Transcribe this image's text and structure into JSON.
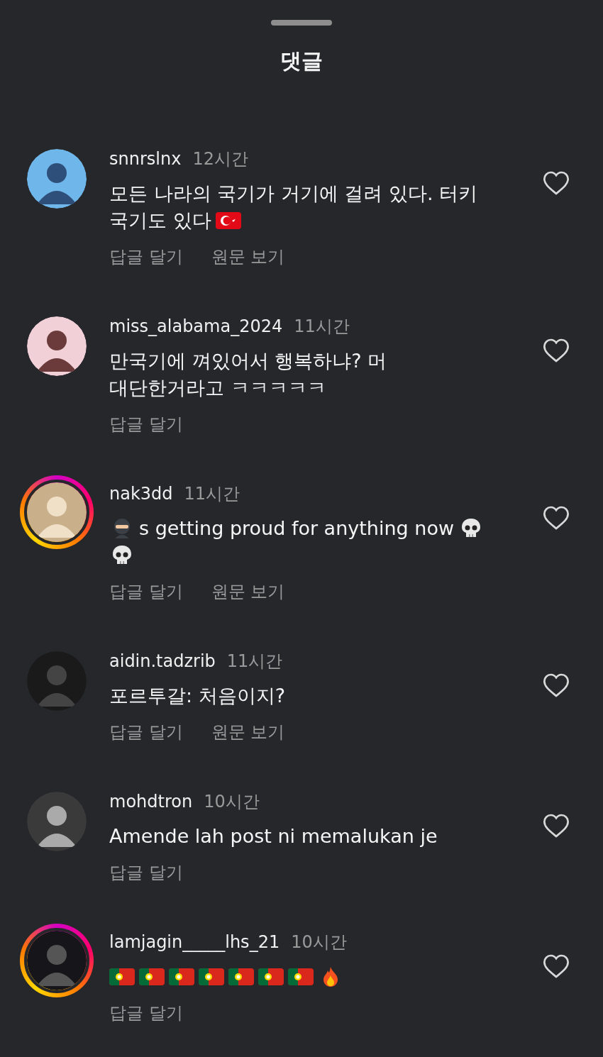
{
  "title": "댓글",
  "comments": [
    {
      "username": "snnrslnx",
      "time": "12시간",
      "story_ring": false,
      "liked": false,
      "lines": [
        [
          {
            "kind": "text",
            "text": "모든 나라의 국기가 거기에 걸려 있다. 터키"
          }
        ],
        [
          {
            "kind": "text",
            "text": "국기도 있다"
          },
          {
            "kind": "flag-tr"
          }
        ]
      ],
      "reply": "답글 달기",
      "translate": "원문 보기"
    },
    {
      "username": "miss_alabama_2024",
      "time": "11시간",
      "story_ring": false,
      "liked": false,
      "lines": [
        [
          {
            "kind": "text",
            "text": "만국기에 껴있어서 행복하냐? 머"
          }
        ],
        [
          {
            "kind": "text",
            "text": "대단한거라고 ㅋㅋㅋㅋㅋ"
          }
        ]
      ],
      "reply": "답글 달기"
    },
    {
      "username": "nak3dd",
      "time": "11시간",
      "story_ring": true,
      "liked": false,
      "lines": [
        [
          {
            "kind": "ninja"
          },
          {
            "kind": "text",
            "text": "s getting proud for anything now"
          },
          {
            "kind": "skull"
          }
        ],
        [
          {
            "kind": "skull"
          }
        ]
      ],
      "reply": "답글 달기",
      "translate": "원문 보기"
    },
    {
      "username": "aidin.tadzrib",
      "time": "11시간",
      "story_ring": false,
      "liked": false,
      "lines": [
        [
          {
            "kind": "text",
            "text": "포르투갈: 처음이지?"
          }
        ]
      ],
      "reply": "답글 달기",
      "translate": "원문 보기"
    },
    {
      "username": "mohdtron",
      "time": "10시간",
      "story_ring": false,
      "liked": false,
      "lines": [
        [
          {
            "kind": "text",
            "text": "Amende lah post ni memalukan je"
          }
        ]
      ],
      "reply": "답글 달기"
    },
    {
      "username": "lamjagin_____lhs_21",
      "time": "10시간",
      "story_ring": true,
      "liked": false,
      "lines": [
        [
          {
            "kind": "flag-pt"
          },
          {
            "kind": "flag-pt"
          },
          {
            "kind": "flag-pt"
          },
          {
            "kind": "flag-pt"
          },
          {
            "kind": "flag-pt"
          },
          {
            "kind": "flag-pt"
          },
          {
            "kind": "flag-pt"
          },
          {
            "kind": "fire"
          }
        ]
      ],
      "reply": "답글 달기"
    }
  ]
}
